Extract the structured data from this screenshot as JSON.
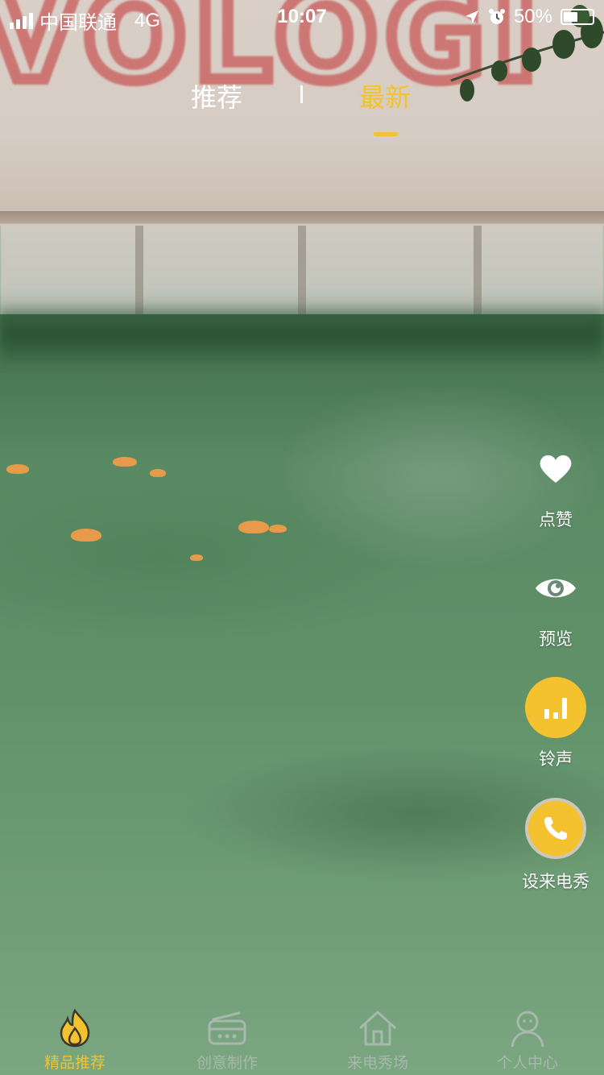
{
  "status_bar": {
    "carrier": "中国联通",
    "network": "4G",
    "time": "10:07",
    "battery_percent": "50%",
    "battery_level": 0.5,
    "icons": [
      "signal-icon",
      "location-arrow-icon",
      "alarm-icon",
      "battery-icon"
    ]
  },
  "top_tabs": {
    "items": [
      {
        "label": "推荐",
        "active": false
      },
      {
        "label": "最新",
        "active": true
      }
    ]
  },
  "actions": {
    "like": {
      "label": "点赞",
      "icon": "heart-icon"
    },
    "preview": {
      "label": "预览",
      "icon": "eye-icon"
    },
    "ringtone": {
      "label": "铃声",
      "icon": "bar-chart-icon"
    },
    "set_call_show": {
      "label": "设来电秀",
      "icon": "phone-icon"
    }
  },
  "bottom_nav": {
    "items": [
      {
        "label": "精品推荐",
        "icon": "flame-icon",
        "active": true
      },
      {
        "label": "创意制作",
        "icon": "radio-icon",
        "active": false
      },
      {
        "label": "来电秀场",
        "icon": "home-icon",
        "active": false
      },
      {
        "label": "个人中心",
        "icon": "user-icon",
        "active": false
      }
    ]
  },
  "colors": {
    "accent": "#f3c22e",
    "inactive_nav": "#a7b8ac",
    "text_light": "#ffffff"
  }
}
